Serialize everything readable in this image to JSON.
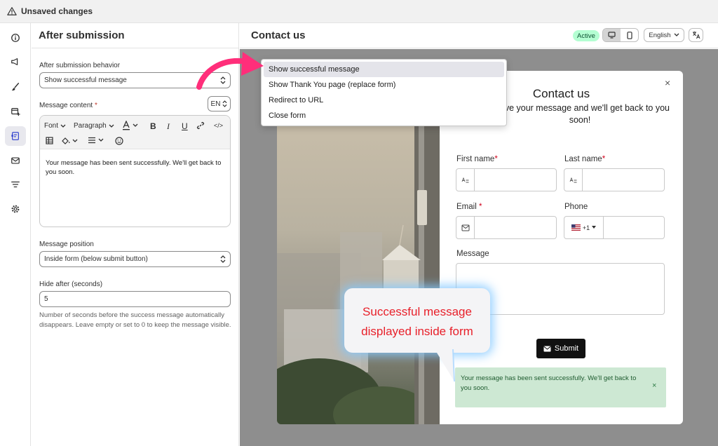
{
  "topbar": {
    "title": "Unsaved changes"
  },
  "panel": {
    "title": "After submission",
    "behavior_label": "After submission behavior",
    "behavior_value": "Show successful message",
    "content_label": "Message content",
    "content_required": "*",
    "lang_code": "EN",
    "toolbar": {
      "font": "Font",
      "paragraph": "Paragraph",
      "bold": "B",
      "italic": "I",
      "underline": "U",
      "code": "</>"
    },
    "message_body": "Your message has been sent successfully. We'll get back to you soon.",
    "position_label": "Message position",
    "position_value": "Inside form (below submit button)",
    "hide_label": "Hide after (seconds)",
    "hide_value": "5",
    "hide_help": "Number of seconds before the success message automatically disappears. Leave empty or set to 0 to keep the message visible."
  },
  "preview": {
    "title": "Contact us",
    "status": "Active",
    "language": "English"
  },
  "dropdown": {
    "options": [
      "Show successful message",
      "Show Thank You page (replace form)",
      "Redirect to URL",
      "Close form"
    ],
    "selected_index": 0
  },
  "form": {
    "title": "Contact us",
    "subtitle": "Leave your message and we'll get back to you soon!",
    "first_name": "First name",
    "last_name": "Last name",
    "email": "Email",
    "phone": "Phone",
    "phone_code": "+1",
    "message": "Message",
    "required_mark": "*",
    "submit": "Submit",
    "close": "×",
    "success_message": "Your message has been sent successfully. We'll get back to you soon.",
    "success_close": "×"
  },
  "callout": {
    "line1": "Successful message",
    "line2": "displayed inside form"
  },
  "colors": {
    "accent_pink": "#ff2e7a",
    "callout_text": "#e8202a",
    "success_bg": "#cde8d3",
    "active_badge": "#b4fed2"
  }
}
